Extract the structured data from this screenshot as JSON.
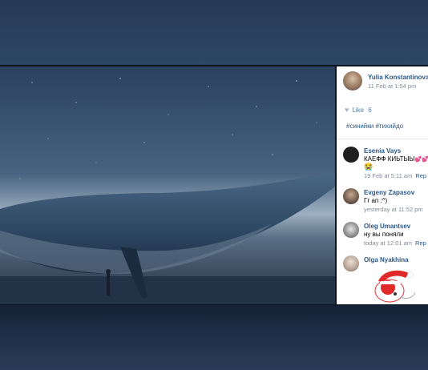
{
  "post": {
    "author": "Yulia Konstantinova",
    "timestamp": "11 Feb at 1:54 pm",
    "like_label": "Like",
    "like_count": "6",
    "hashtags": "#синийки #тихийдо"
  },
  "comments": [
    {
      "author": "Esenia Vays",
      "text": "КАЕФФ КИЬТЫЫ",
      "emoji": "💕💕",
      "emoji2": "😭",
      "timestamp": "19 Feb at 5:11 am",
      "reply_label": "Rep"
    },
    {
      "author": "Evgeny Zapasov",
      "text": "Гг ап :^)",
      "timestamp": "yesterday at 11:52 pm",
      "reply_label": ""
    },
    {
      "author": "Oleg Umantsev",
      "text": "ну вы поняли",
      "timestamp": "today at 12:01 am",
      "reply_label": "Rep"
    },
    {
      "author": "Olga Nyakhina",
      "text": "",
      "timestamp": "",
      "reply_label": ""
    }
  ],
  "icons": {
    "like": "heart-icon"
  },
  "colors": {
    "link": "#2a5885",
    "meta": "#828a99",
    "panel_bg": "#ffffff"
  }
}
